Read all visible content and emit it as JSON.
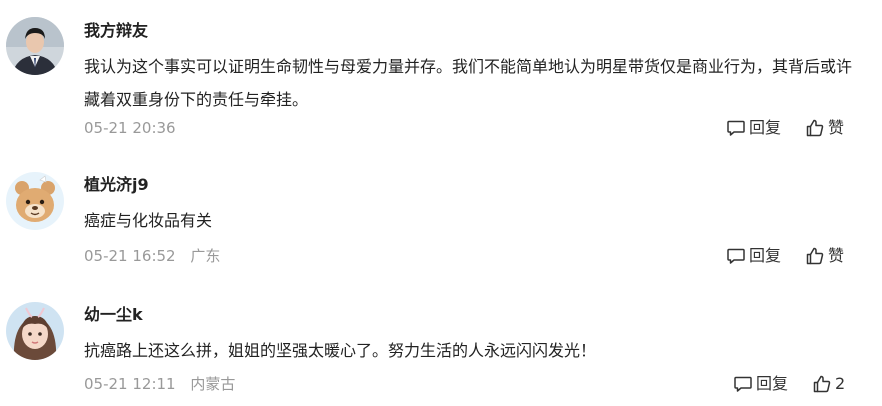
{
  "comments": [
    {
      "username": "我方辩友",
      "text": "我认为这个事实可以证明生命韧性与母爱力量并存。我们不能简单地认为明星带货仅是商业行为，其背后或许藏着双重身份下的责任与牵挂。",
      "timestamp": "05-21 20:36",
      "location": "",
      "reply_label": "回复",
      "like_label": "赞",
      "avatar_icon": "man-in-suit-avatar"
    },
    {
      "username": "植光济j9",
      "text": "癌症与化妆品有关",
      "timestamp": "05-21 16:52",
      "location": "广东",
      "reply_label": "回复",
      "like_label": "赞",
      "avatar_icon": "cartoon-bear-avatar"
    },
    {
      "username": "幼一尘k",
      "text": "抗癌路上还这么拼，姐姐的坚强太暖心了。努力生活的人永远闪闪发光！",
      "timestamp": "05-21 12:11",
      "location": "内蒙古",
      "reply_label": "回复",
      "like_label": "2",
      "avatar_icon": "girl-photo-avatar"
    }
  ],
  "colors": {
    "username": "#222222",
    "text": "#222222",
    "meta": "#999999",
    "action": "#333333"
  }
}
